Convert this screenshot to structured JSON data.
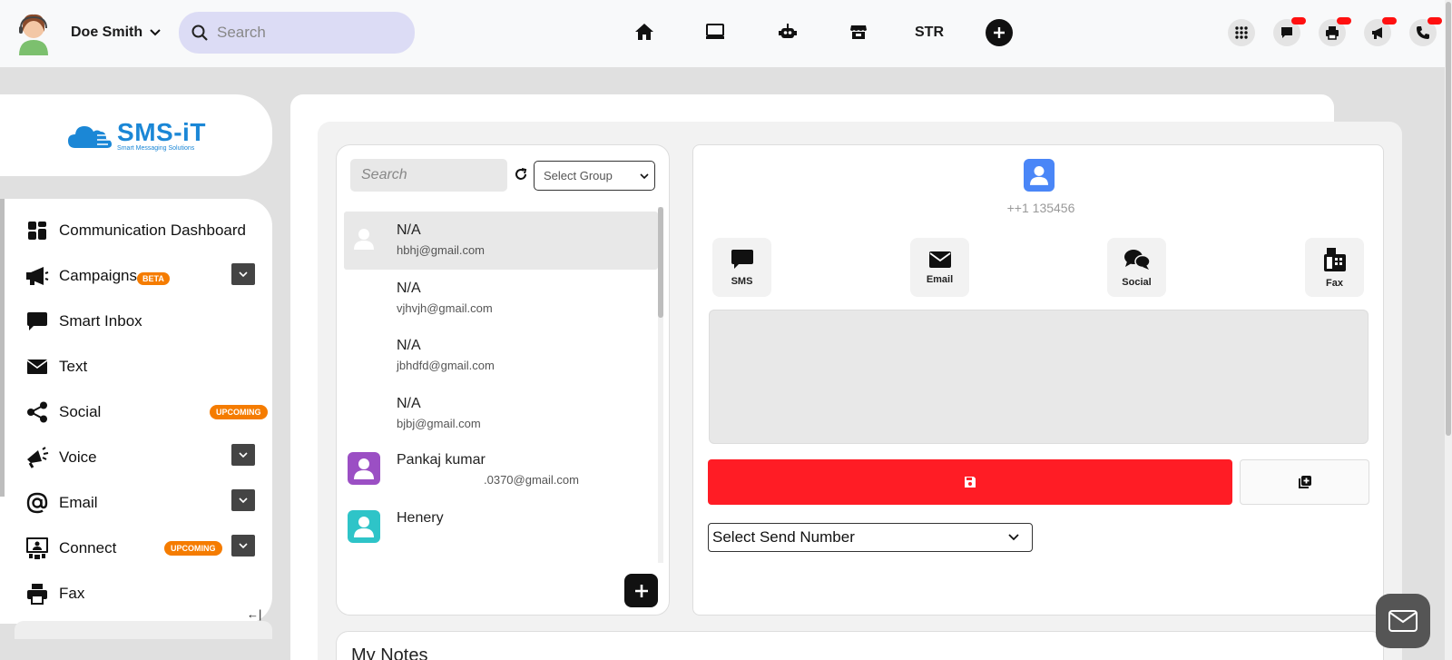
{
  "header": {
    "user_name": "Doe Smith",
    "search_placeholder": "Search",
    "nav_str": "STR",
    "icons": [
      "home-icon",
      "monitor-icon",
      "robot-icon",
      "store-icon",
      "plus-icon",
      "apps-grid-icon",
      "chat-icon",
      "print-icon",
      "megaphone-icon",
      "phone-icon"
    ]
  },
  "logo": {
    "name": "SMS-iT",
    "tagline": "Smart Messaging Solutions"
  },
  "sidebar": {
    "items": [
      {
        "label": "Communication Dashboard",
        "icon": "dashboard-icon"
      },
      {
        "label": "Campaigns",
        "badge": "BETA",
        "icon": "megaphone-icon",
        "expandable": true
      },
      {
        "label": "Smart Inbox",
        "icon": "chat-bubble-icon"
      },
      {
        "label": "Text",
        "icon": "envelope-icon"
      },
      {
        "label": "Social",
        "badge": "UPCOMING",
        "icon": "share-icon"
      },
      {
        "label": "Voice",
        "icon": "voice-megaphone-icon",
        "expandable": true
      },
      {
        "label": "Email",
        "icon": "at-icon",
        "expandable": true
      },
      {
        "label": "Connect",
        "badge": "UPCOMING",
        "icon": "video-connect-icon",
        "expandable": true
      },
      {
        "label": "Fax",
        "icon": "printer-icon"
      }
    ],
    "collapse_label": "←|"
  },
  "contacts": {
    "search_placeholder": "Search",
    "group_select": "Select Group",
    "list": [
      {
        "name": "N/A",
        "email": "hbhj@gmail.com"
      },
      {
        "name": "N/A",
        "email": "vjhvjh@gmail.com"
      },
      {
        "name": "N/A",
        "email": "jbhdfd@gmail.com"
      },
      {
        "name": "N/A",
        "email": "bjbj@gmail.com"
      },
      {
        "name": "Pankaj kumar",
        "email": ".0370@gmail.com",
        "avatar_color": "#9b4fc4"
      },
      {
        "name": "Henery",
        "email": "",
        "avatar_color": "#2ec4c8"
      }
    ]
  },
  "detail": {
    "phone": "++1 135456",
    "channels": [
      {
        "label": "SMS",
        "icon": "sms-icon"
      },
      {
        "label": "Email",
        "icon": "email-icon"
      },
      {
        "label": "Social",
        "icon": "social-chat-icon"
      },
      {
        "label": "Fax",
        "icon": "fax-icon"
      }
    ],
    "send_number_select": "Select Send Number"
  },
  "notes": {
    "title": "My Notes"
  },
  "colors": {
    "primary_red": "#ff1c25",
    "badge_orange": "#f57c00",
    "avatar_blue": "#4a86f7"
  }
}
